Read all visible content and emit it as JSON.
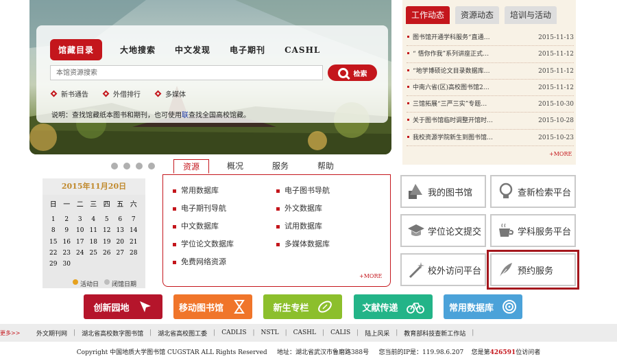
{
  "search": {
    "tabs": [
      "馆藏目录",
      "大地搜索",
      "中文发现",
      "电子期刊",
      "CASHL"
    ],
    "placeholder": "本馆资源搜索",
    "button_label": "检索",
    "quick_links": [
      "新书通告",
      "外借排行",
      "多媒体"
    ],
    "note_prefix": "说明：查找馆藏纸本图书和期刊，也可使用",
    "note_link": "联",
    "note_suffix": "查找全国高校馆藏。"
  },
  "news": {
    "tabs": [
      "工作动态",
      "资源动态",
      "培训与活动"
    ],
    "items": [
      {
        "title": "图书馆开通学科服务“直通…",
        "date": "2015-11-13"
      },
      {
        "title": "“ 悟你作我”系列讲座正式…",
        "date": "2015-11-12"
      },
      {
        "title": "“地学博硕论文目录数据库…",
        "date": "2015-11-12"
      },
      {
        "title": "中南六省(区)高校图书馆2…",
        "date": "2015-11-12"
      },
      {
        "title": "三馆拓展“三严三实”专题…",
        "date": "2015-10-30"
      },
      {
        "title": "关于图书馆临时调整开馆时…",
        "date": "2015-10-28"
      },
      {
        "title": "我校资源学院新生到图书馆…",
        "date": "2015-10-23"
      }
    ],
    "more": "+MORE"
  },
  "calendar": {
    "title": "2015年11月20日",
    "weekdays": [
      "日",
      "一",
      "二",
      "三",
      "四",
      "五",
      "六"
    ],
    "weeks": [
      [
        "",
        "",
        "",
        "",
        "",
        "",
        ""
      ],
      [
        "1",
        "2",
        "3",
        "4",
        "5",
        "6",
        "7"
      ],
      [
        "8",
        "9",
        "10",
        "11",
        "12",
        "13",
        "14"
      ],
      [
        "15",
        "16",
        "17",
        "18",
        "19",
        "20",
        "21"
      ],
      [
        "22",
        "23",
        "24",
        "25",
        "26",
        "27",
        "28"
      ],
      [
        "29",
        "30",
        "",
        "",
        "",
        "",
        ""
      ]
    ],
    "legend_active": "活动日",
    "legend_closed": "闭馆日期"
  },
  "resources": {
    "tabs": [
      "资源",
      "概况",
      "服务",
      "帮助"
    ],
    "left": [
      "常用数据库",
      "电子期刊导航",
      "中文数据库",
      "学位论文数据库",
      "免费网络资源"
    ],
    "right": [
      "电子图书导航",
      "外文数据库",
      "试用数据库",
      "多媒体数据库"
    ],
    "more": "+MORE"
  },
  "services": [
    "我的图书馆",
    "查新检索平台",
    "学位论文提交",
    "学科服务平台",
    "校外访问平台",
    "预约服务"
  ],
  "color_buttons": [
    {
      "label": "创新园地",
      "color": "#b5152b"
    },
    {
      "label": "移动图书馆",
      "color": "#f0752a"
    },
    {
      "label": "新生专栏",
      "color": "#8cbf2c"
    },
    {
      "label": "文献传递",
      "color": "#23b488"
    },
    {
      "label": "常用数据库",
      "color": "#4ba2d9"
    }
  ],
  "links": [
    "外文期刊网",
    "湖北省高校数字图书馆",
    "湖北省高校图工委",
    "CADLIS",
    "NSTL",
    "CASHL",
    "CALIS",
    "陆上风采",
    "教育部科技查新工作站"
  ],
  "links_more": "更多>>",
  "footer": {
    "copyright": "Copyright   中国地质大学图书馆   CUGSTAR ALL Rights Reserved",
    "address": "地址：湖北省武汉市鲁磨路388号",
    "ip": "您当前的IP是：119.98.6.207",
    "visitor_prefix": "您是第",
    "visitor_count": "426591",
    "visitor_suffix": "位访问者"
  },
  "colors": {
    "brand_red": "#c4161c",
    "news_bg": "#f8f2e6",
    "calendar_gold": "#c0892c"
  }
}
